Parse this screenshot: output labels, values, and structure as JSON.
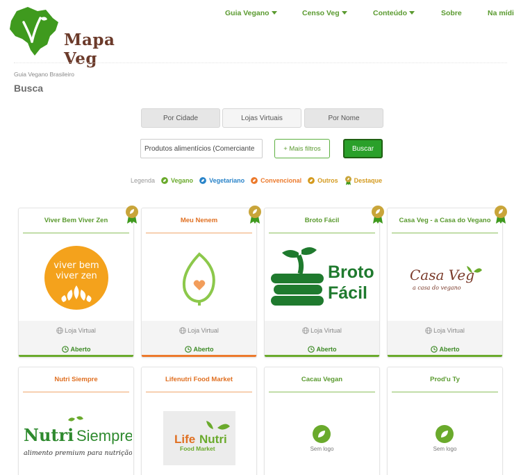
{
  "header": {
    "logo_text": "Mapa Veg",
    "nav": [
      {
        "label": "Guia Vegano",
        "dropdown": true
      },
      {
        "label": "Censo Veg",
        "dropdown": true
      },
      {
        "label": "Conteúdo",
        "dropdown": true
      },
      {
        "label": "Sobre",
        "dropdown": false
      },
      {
        "label": "Na mídia",
        "dropdown": false
      }
    ]
  },
  "breadcrumb": "Guia Vegano Brasileiro",
  "page_title": "Busca",
  "tabs": [
    {
      "label": "Por Cidade",
      "active": false
    },
    {
      "label": "Lojas Virtuais",
      "active": true
    },
    {
      "label": "Por Nome",
      "active": false
    }
  ],
  "search": {
    "value": "Produtos alimentícios (Comerciante",
    "filters_label": "+ Mais filtros",
    "submit_label": "Buscar"
  },
  "legend": {
    "label": "Legenda",
    "items": [
      {
        "label": "Vegano",
        "color": "#6aaa2c"
      },
      {
        "label": "Vegetariano",
        "color": "#2a84c9"
      },
      {
        "label": "Convencional",
        "color": "#ec7a2c"
      },
      {
        "label": "Outros",
        "color": "#d49a1e"
      },
      {
        "label": "Destaque",
        "color": "#c9a53a"
      }
    ]
  },
  "colors": {
    "vegano": "#6aaa2c",
    "convencional": "#ec7a2c",
    "brand_green": "#5a9a2f",
    "brand_brown": "#6b3a2a"
  },
  "cards": [
    {
      "name": "Viver Bem Viver Zen",
      "category": "vegano",
      "featured": true,
      "logo": "viver-bem-viver-zen-logo",
      "store_type": "Loja Virtual",
      "status": "Aberto"
    },
    {
      "name": "Meu Nenem",
      "category": "convencional",
      "featured": true,
      "logo": "meu-nenem-logo",
      "store_type": "Loja Virtual",
      "status": "Aberto"
    },
    {
      "name": "Broto Fácil",
      "category": "vegano",
      "featured": true,
      "logo": "broto-facil-logo",
      "store_type": "Loja Virtual",
      "status": "Aberto"
    },
    {
      "name": "Casa Veg - a Casa do Vegano",
      "category": "vegano",
      "featured": true,
      "logo": "casa-veg-logo",
      "store_type": "Loja Virtual",
      "status": "Aberto"
    },
    {
      "name": "Nutri Siempre",
      "category": "convencional",
      "featured": false,
      "logo": "nutri-siempre-logo"
    },
    {
      "name": "Lifenutri Food Market",
      "category": "convencional",
      "featured": false,
      "logo": "lifenutri-logo"
    },
    {
      "name": "Cacau Vegan",
      "category": "vegano",
      "featured": false,
      "logo": "no-logo",
      "no_logo_text": "Sem logo"
    },
    {
      "name": "Prod'u Ty",
      "category": "vegano",
      "featured": false,
      "logo": "no-logo",
      "no_logo_text": "Sem logo"
    }
  ],
  "logo_texts": {
    "viver": [
      "viver bem",
      "viver zen"
    ],
    "broto": [
      "Broto",
      "Fácil"
    ],
    "casa": [
      "Casa Veg",
      "a casa do vegano"
    ],
    "nutri": [
      "Nutri",
      "Siempre",
      "alimento premium para nutrição!"
    ],
    "lifenutri": [
      "Life",
      "Nutri",
      "Food Market"
    ]
  }
}
